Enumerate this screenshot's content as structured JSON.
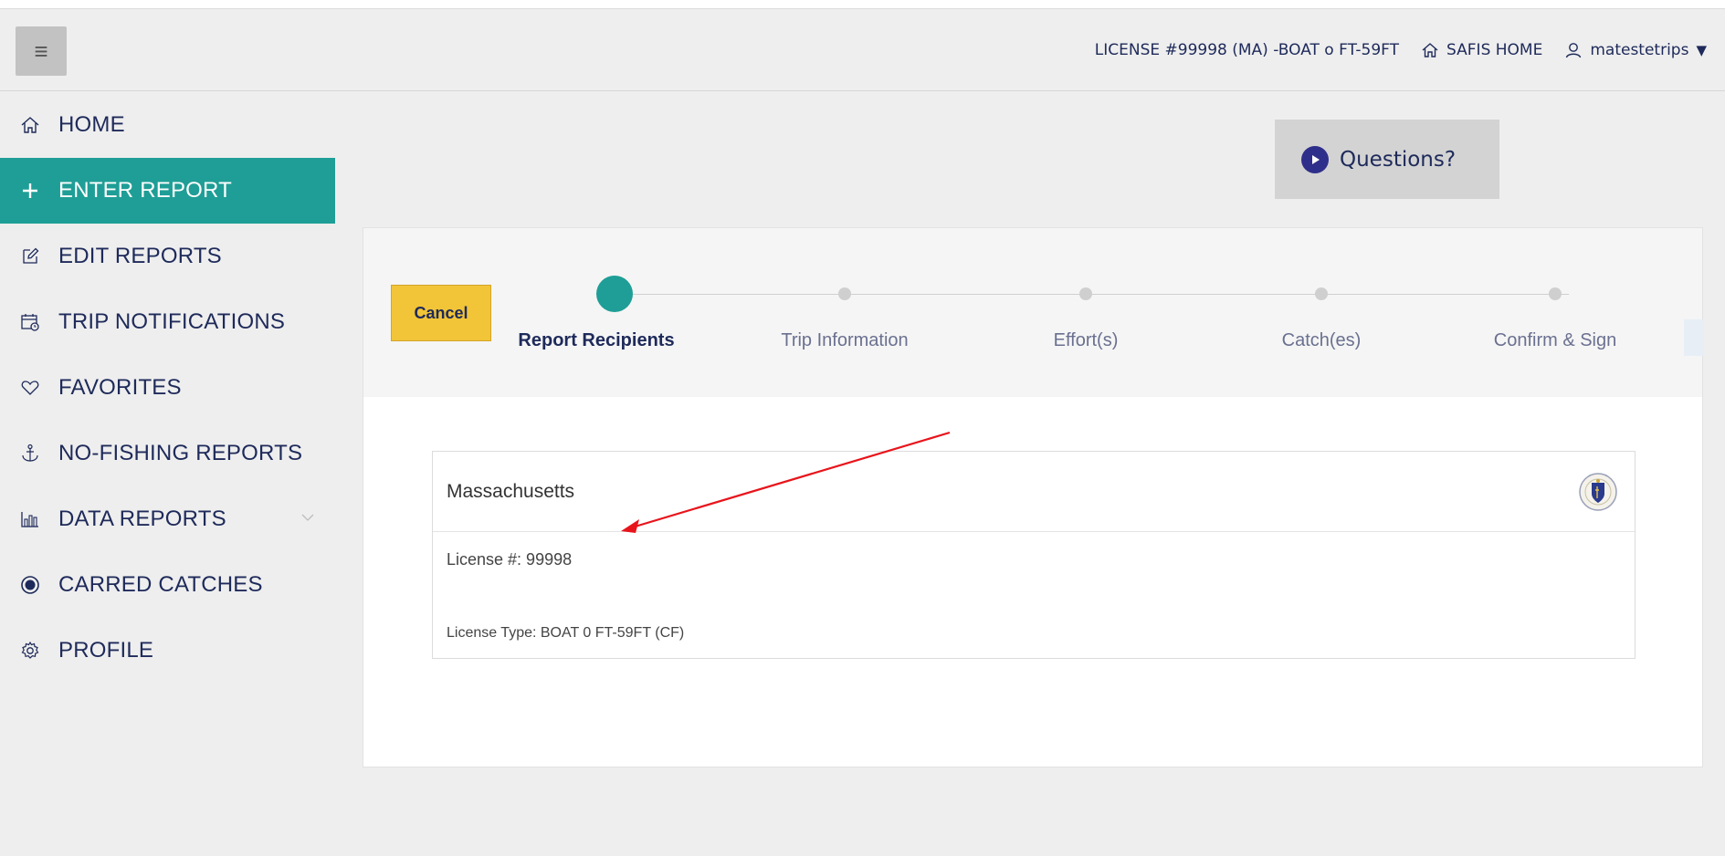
{
  "header": {
    "license_text": "LICENSE #99998 (MA) -BOAT o FT-59FT",
    "home_label": "SAFIS HOME",
    "username": "matestetrips",
    "user_dropdown_glyph": "▼",
    "menu_icon": "hamburger-icon"
  },
  "sidebar": {
    "items": [
      {
        "label": "HOME",
        "icon": "home-icon"
      },
      {
        "label": "ENTER REPORT",
        "icon": "plus-icon",
        "active": true
      },
      {
        "label": "EDIT REPORTS",
        "icon": "edit-icon"
      },
      {
        "label": "TRIP NOTIFICATIONS",
        "icon": "calendar-clock-icon"
      },
      {
        "label": "FAVORITES",
        "icon": "heart-icon"
      },
      {
        "label": "NO-FISHING REPORTS",
        "icon": "anchor-icon"
      },
      {
        "label": "DATA REPORTS",
        "icon": "bar-chart-icon",
        "expandable": true
      },
      {
        "label": "CARRED CATCHES",
        "icon": "radio-dot-icon"
      },
      {
        "label": "PROFILE",
        "icon": "gear-icon"
      }
    ]
  },
  "questions": {
    "label": "Questions?"
  },
  "stepper": {
    "cancel_label": "Cancel",
    "steps": [
      {
        "label": "Report Recipients",
        "active": true
      },
      {
        "label": "Trip Information"
      },
      {
        "label": "Effort(s)"
      },
      {
        "label": "Catch(es)"
      },
      {
        "label": "Confirm & Sign"
      }
    ]
  },
  "recipient": {
    "state": "Massachusetts",
    "license": "License #: 99998",
    "license_type": "License Type: BOAT 0 FT-59FT (CF)"
  },
  "colors": {
    "accent": "#1e9e96",
    "text": "#1e2a5a",
    "cancel": "#f2c438",
    "annotation_arrow": "#e8141b"
  }
}
